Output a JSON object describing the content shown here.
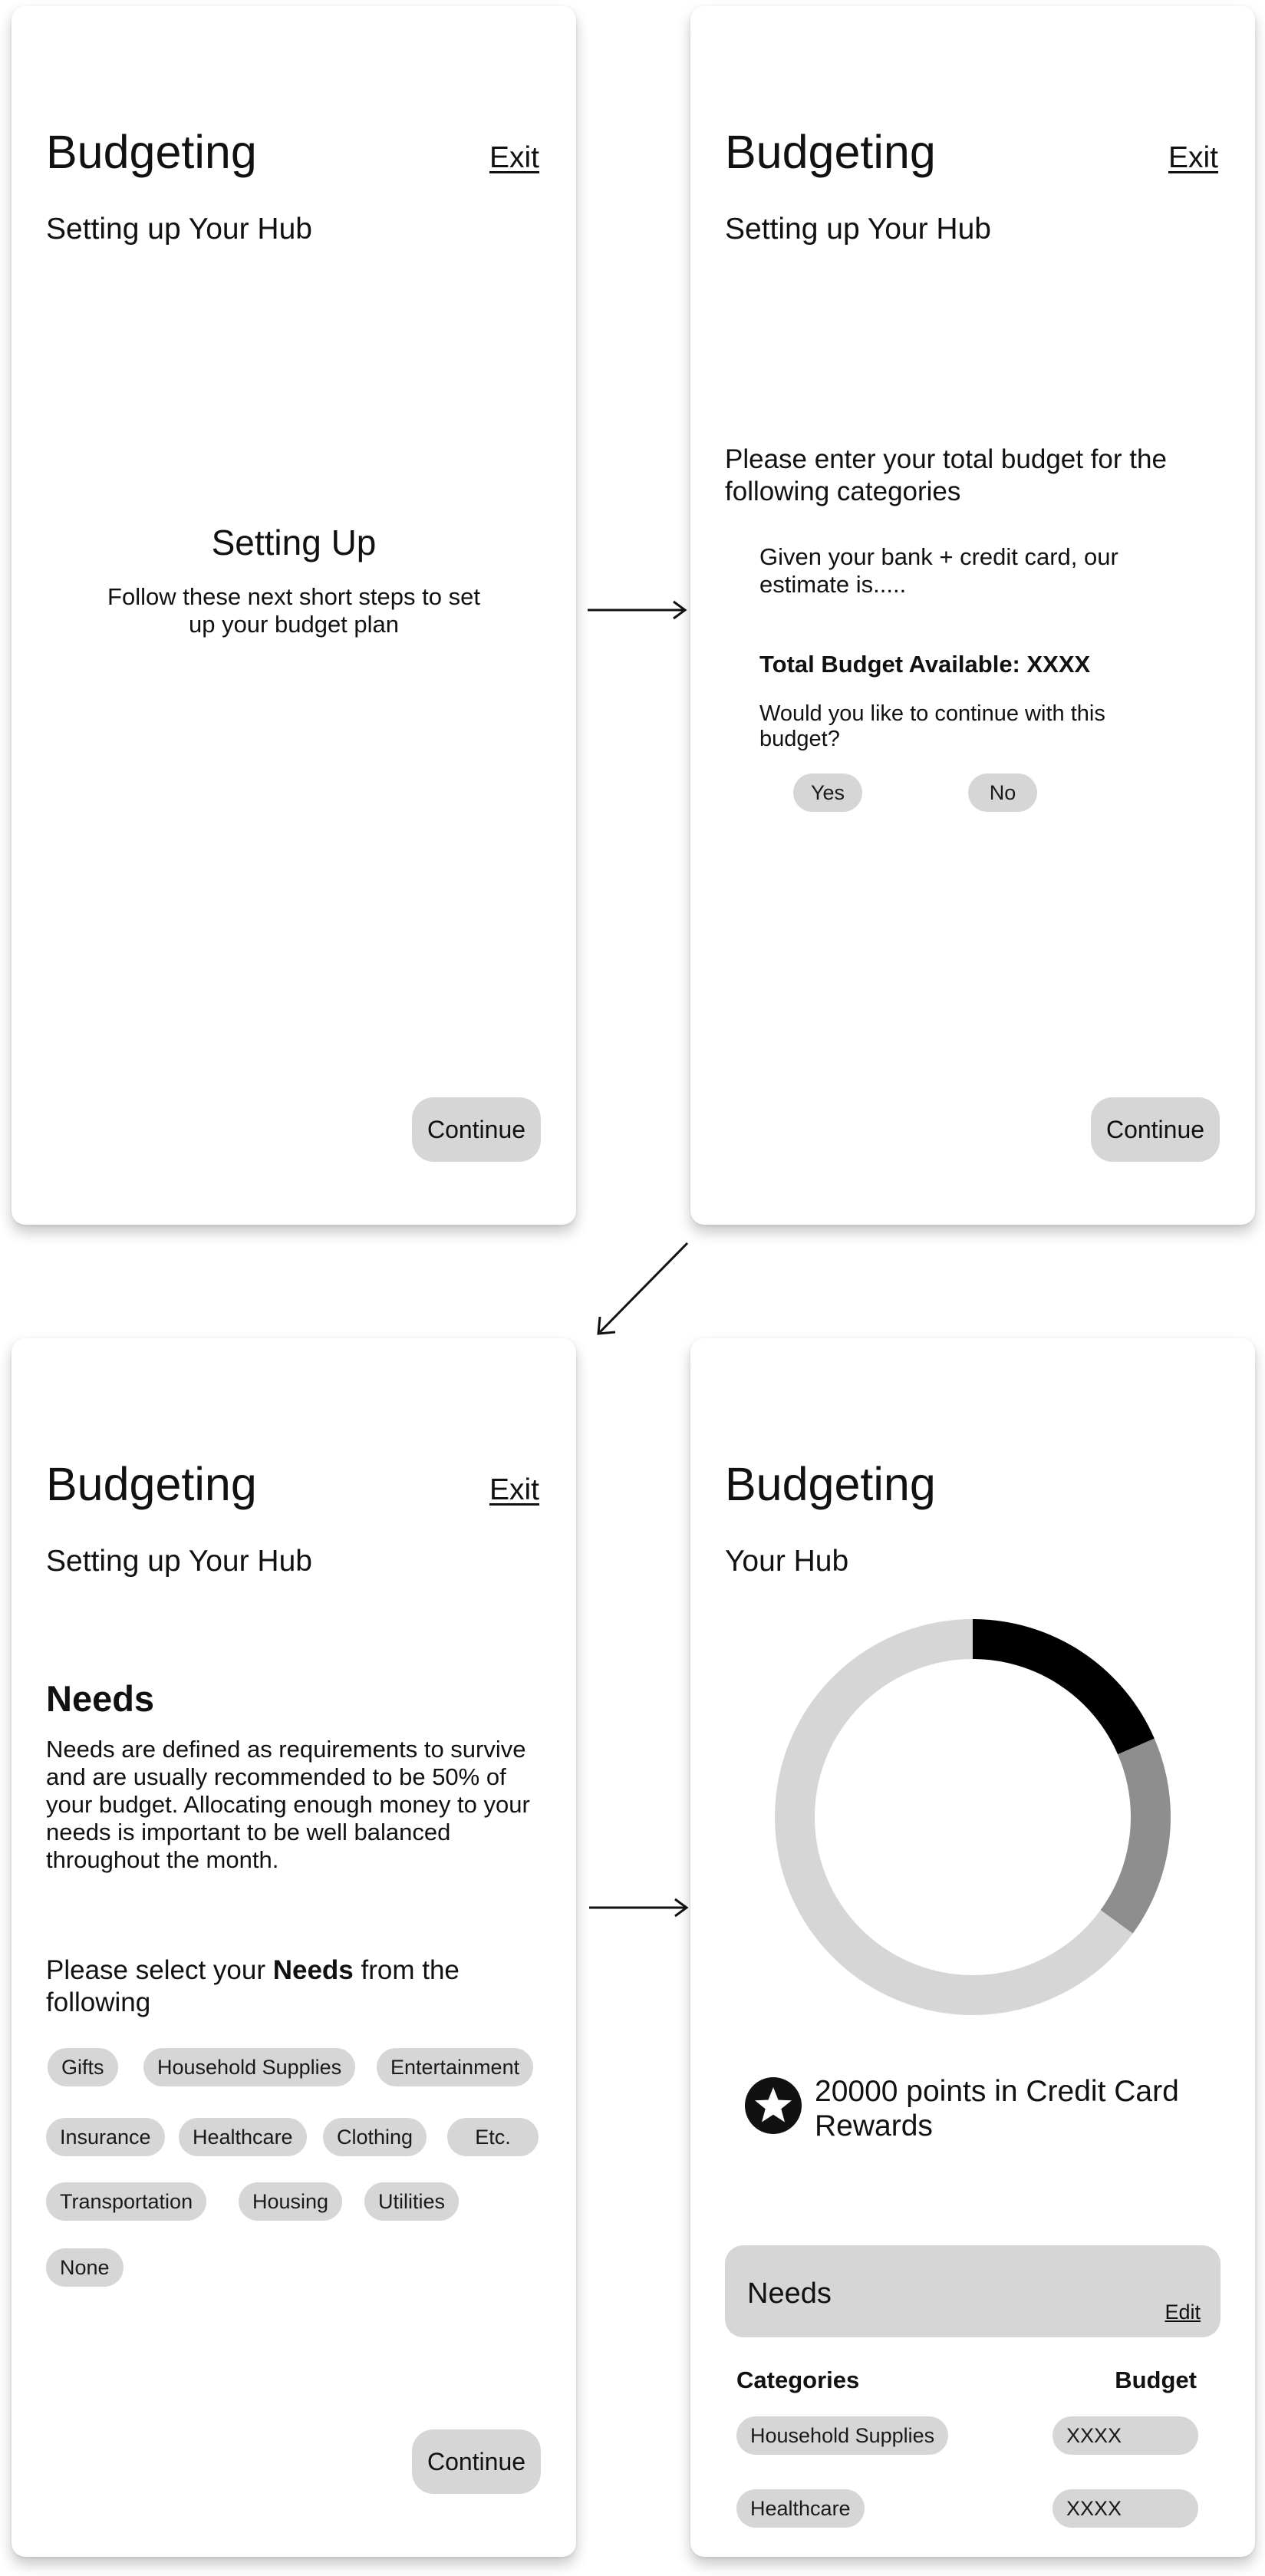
{
  "common": {
    "app_title": "Budgeting",
    "exit_label": "Exit",
    "continue_label": "Continue",
    "setup_subtitle": "Setting up Your Hub"
  },
  "screen1": {
    "heading": "Setting Up",
    "text": "Follow these next short steps to set up your budget plan"
  },
  "screen2": {
    "prompt": "Please enter your total budget for the following categories",
    "estimate": "Given your bank + credit card, our estimate is.....",
    "total": "Total Budget Available: XXXX",
    "question": "Would you like to continue with this budget?",
    "yes_label": "Yes",
    "no_label": "No"
  },
  "screen3": {
    "heading": "Needs",
    "description": "Needs are defined as requirements to survive and are usually recommended to be 50% of your budget. Allocating enough money to your needs is important to be well balanced throughout the month.",
    "select_prefix": "Please select your ",
    "select_bold": "Needs",
    "select_suffix": " from the following",
    "chips": [
      "Gifts",
      "Household Supplies",
      "Entertainment",
      "Insurance",
      "Healthcare",
      "Clothing",
      "Etc.",
      "Transportation",
      "Housing",
      "Utilities",
      "None"
    ]
  },
  "screen4": {
    "subtitle": "Your Hub",
    "points_text": "20000 points in Credit Card Rewards",
    "needs_label": "Needs",
    "edit_label": "Edit",
    "categories_header": "Categories",
    "budget_header": "Budget",
    "rows": [
      {
        "category": "Household Supplies",
        "budget": "XXXX"
      },
      {
        "category": "Healthcare",
        "budget": "XXXX"
      }
    ],
    "donut": {
      "segments": [
        {
          "fraction": 0.185,
          "color": "#000000"
        },
        {
          "fraction": 0.165,
          "color": "#8e8e8e"
        },
        {
          "fraction": 0.65,
          "color": "#d6d6d6"
        }
      ]
    },
    "icons": {
      "points": "star-icon"
    }
  }
}
